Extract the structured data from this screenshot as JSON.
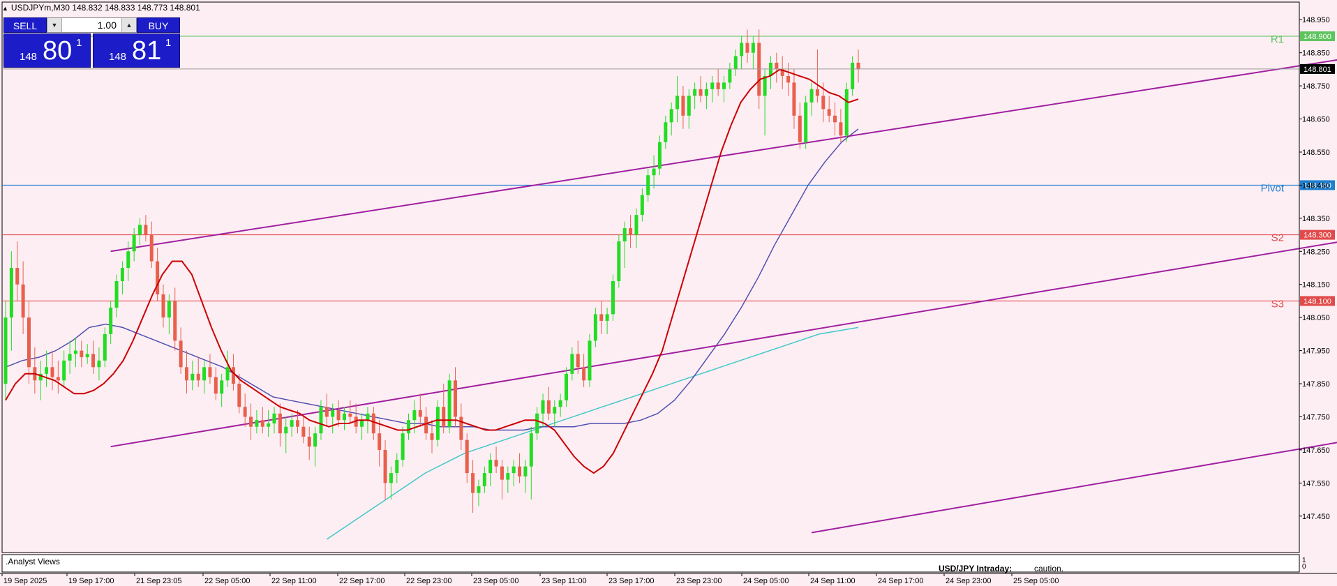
{
  "header": {
    "symbol_info": "USDJPYm,M30  148.832 148.833 148.773 148.801"
  },
  "trade_panel": {
    "sell_label": "SELL",
    "buy_label": "BUY",
    "lot": "1.00",
    "bid": {
      "small": "148",
      "big": "80",
      "sup": "1"
    },
    "ask": {
      "small": "148",
      "big": "81",
      "sup": "1"
    }
  },
  "indicator_panel": {
    "name": ".Analyst Views",
    "text_bold": "USD/JPY Intraday:",
    "text": "caution.",
    "scale_top": "1",
    "scale_bottom": "0"
  },
  "chart_data": {
    "type": "candlestick",
    "symbol": "USDJPYm",
    "timeframe": "M30",
    "ylim": [
      147.38,
      148.98
    ],
    "y_ticks": [
      "148.950",
      "148.850",
      "148.750",
      "148.650",
      "148.550",
      "148.450",
      "148.350",
      "148.250",
      "148.150",
      "148.050",
      "147.950",
      "147.850",
      "147.750",
      "147.650",
      "147.550",
      "147.450"
    ],
    "x_ticks": [
      "19 Sep 2025",
      "19 Sep 17:00",
      "21 Sep 23:05",
      "22 Sep 05:00",
      "22 Sep 11:00",
      "22 Sep 17:00",
      "22 Sep 23:00",
      "23 Sep 05:00",
      "23 Sep 11:00",
      "23 Sep 17:00",
      "23 Sep 23:00",
      "24 Sep 05:00",
      "24 Sep 11:00",
      "24 Sep 17:00",
      "24 Sep 23:00",
      "25 Sep 05:00"
    ],
    "current_price": "148.801",
    "levels": [
      {
        "name": "R1",
        "value": 148.9,
        "label": "148.900",
        "color": "#5ec45e"
      },
      {
        "name": "Pivot",
        "value": 148.45,
        "label": "148.450",
        "color": "#1e7fd0"
      },
      {
        "name": "S2",
        "value": 148.3,
        "label": "148.300",
        "color": "#e14a4a"
      },
      {
        "name": "S3",
        "value": 148.1,
        "label": "148.100",
        "color": "#e14a4a"
      }
    ],
    "bull_color": "#22dd22",
    "bear_color": "#e8604c",
    "ma_colors": {
      "fast": "#cc0000",
      "mid": "#5050b0",
      "slow": "#40c8c8",
      "channel": "#a020a0"
    },
    "ohlc": [
      [
        147.85,
        148.1,
        147.8,
        148.05
      ],
      [
        148.05,
        148.25,
        147.95,
        148.2
      ],
      [
        148.2,
        148.28,
        148.1,
        148.15
      ],
      [
        148.15,
        148.22,
        148.0,
        148.05
      ],
      [
        148.05,
        148.1,
        147.85,
        147.9
      ],
      [
        147.9,
        147.96,
        147.82,
        147.86
      ],
      [
        147.86,
        147.92,
        147.8,
        147.88
      ],
      [
        147.88,
        147.95,
        147.84,
        147.9
      ],
      [
        147.9,
        147.95,
        147.83,
        147.87
      ],
      [
        147.87,
        147.92,
        147.82,
        147.86
      ],
      [
        147.86,
        147.95,
        147.84,
        147.92
      ],
      [
        147.92,
        147.98,
        147.88,
        147.94
      ],
      [
        147.94,
        147.99,
        147.9,
        147.95
      ],
      [
        147.95,
        147.98,
        147.9,
        147.93
      ],
      [
        147.93,
        147.97,
        147.91,
        147.94
      ],
      [
        147.94,
        147.98,
        147.88,
        147.9
      ],
      [
        147.9,
        147.96,
        147.86,
        147.92
      ],
      [
        147.92,
        148.02,
        147.9,
        148.0
      ],
      [
        148.0,
        148.1,
        147.97,
        148.08
      ],
      [
        148.08,
        148.18,
        148.05,
        148.16
      ],
      [
        148.16,
        148.22,
        148.12,
        148.2
      ],
      [
        148.2,
        148.28,
        148.16,
        148.25
      ],
      [
        148.25,
        148.32,
        148.22,
        148.3
      ],
      [
        148.3,
        148.35,
        148.27,
        148.33
      ],
      [
        148.33,
        148.36,
        148.28,
        148.3
      ],
      [
        148.3,
        148.34,
        148.2,
        148.22
      ],
      [
        148.22,
        148.26,
        148.1,
        148.12
      ],
      [
        148.12,
        148.15,
        148.02,
        148.05
      ],
      [
        148.05,
        148.12,
        148.0,
        148.1
      ],
      [
        148.1,
        148.14,
        147.95,
        147.98
      ],
      [
        147.98,
        148.02,
        147.88,
        147.9
      ],
      [
        147.9,
        147.95,
        147.82,
        147.86
      ],
      [
        147.86,
        147.92,
        147.83,
        147.88
      ],
      [
        147.88,
        147.93,
        147.84,
        147.86
      ],
      [
        147.86,
        147.92,
        147.82,
        147.9
      ],
      [
        147.9,
        147.94,
        147.85,
        147.87
      ],
      [
        147.87,
        147.9,
        147.8,
        147.82
      ],
      [
        147.82,
        147.88,
        147.78,
        147.86
      ],
      [
        147.86,
        147.95,
        147.84,
        147.9
      ],
      [
        147.9,
        147.94,
        147.83,
        147.85
      ],
      [
        147.85,
        147.88,
        147.76,
        147.78
      ],
      [
        147.78,
        147.82,
        147.72,
        147.75
      ],
      [
        147.75,
        147.79,
        147.68,
        147.72
      ],
      [
        147.72,
        147.77,
        147.7,
        147.74
      ],
      [
        147.74,
        147.78,
        147.7,
        147.72
      ],
      [
        147.72,
        147.77,
        147.69,
        147.73
      ],
      [
        147.73,
        147.78,
        147.7,
        147.76
      ],
      [
        147.76,
        147.79,
        147.66,
        147.7
      ],
      [
        147.7,
        147.75,
        147.64,
        147.72
      ],
      [
        147.72,
        147.76,
        147.69,
        147.74
      ],
      [
        147.74,
        147.77,
        147.7,
        147.72
      ],
      [
        147.72,
        147.75,
        147.67,
        147.69
      ],
      [
        147.69,
        147.72,
        147.62,
        147.66
      ],
      [
        147.66,
        147.72,
        147.6,
        147.7
      ],
      [
        147.7,
        147.8,
        147.68,
        147.78
      ],
      [
        147.78,
        147.82,
        147.72,
        147.75
      ],
      [
        147.75,
        147.79,
        147.7,
        147.77
      ],
      [
        147.77,
        147.8,
        147.72,
        147.74
      ],
      [
        147.74,
        147.78,
        147.71,
        147.76
      ],
      [
        147.76,
        147.8,
        147.73,
        147.75
      ],
      [
        147.75,
        147.79,
        147.7,
        147.72
      ],
      [
        147.72,
        147.76,
        147.68,
        147.74
      ],
      [
        147.74,
        147.78,
        147.7,
        147.76
      ],
      [
        147.76,
        147.78,
        147.68,
        147.7
      ],
      [
        147.7,
        147.74,
        147.6,
        147.65
      ],
      [
        147.65,
        147.68,
        147.5,
        147.55
      ],
      [
        147.55,
        147.6,
        147.5,
        147.58
      ],
      [
        147.58,
        147.64,
        147.55,
        147.62
      ],
      [
        147.62,
        147.72,
        147.6,
        147.7
      ],
      [
        147.7,
        147.76,
        147.68,
        147.74
      ],
      [
        147.74,
        147.8,
        147.7,
        147.77
      ],
      [
        147.77,
        147.82,
        147.72,
        147.75
      ],
      [
        147.75,
        147.78,
        147.68,
        147.7
      ],
      [
        147.7,
        147.74,
        147.64,
        147.68
      ],
      [
        147.68,
        147.8,
        147.66,
        147.78
      ],
      [
        147.78,
        147.85,
        147.7,
        147.72
      ],
      [
        147.72,
        147.88,
        147.7,
        147.86
      ],
      [
        147.86,
        147.9,
        147.72,
        147.75
      ],
      [
        147.75,
        147.79,
        147.65,
        147.68
      ],
      [
        147.68,
        147.7,
        147.55,
        147.58
      ],
      [
        147.58,
        147.62,
        147.46,
        147.52
      ],
      [
        147.52,
        147.56,
        147.48,
        147.54
      ],
      [
        147.54,
        147.6,
        147.52,
        147.58
      ],
      [
        147.58,
        147.64,
        147.54,
        147.62
      ],
      [
        147.62,
        147.66,
        147.58,
        147.6
      ],
      [
        147.6,
        147.62,
        147.5,
        147.56
      ],
      [
        147.56,
        147.6,
        147.52,
        147.58
      ],
      [
        147.58,
        147.62,
        147.54,
        147.6
      ],
      [
        147.6,
        147.64,
        147.55,
        147.57
      ],
      [
        147.57,
        147.62,
        147.52,
        147.6
      ],
      [
        147.6,
        147.72,
        147.5,
        147.7
      ],
      [
        147.7,
        147.78,
        147.68,
        147.76
      ],
      [
        147.76,
        147.82,
        147.72,
        147.8
      ],
      [
        147.8,
        147.84,
        147.74,
        147.76
      ],
      [
        147.76,
        147.8,
        147.72,
        147.78
      ],
      [
        147.78,
        147.82,
        147.75,
        147.8
      ],
      [
        147.8,
        147.9,
        147.78,
        147.88
      ],
      [
        147.88,
        147.96,
        147.86,
        147.94
      ],
      [
        147.94,
        147.98,
        147.88,
        147.9
      ],
      [
        147.9,
        147.94,
        147.84,
        147.86
      ],
      [
        147.86,
        148.0,
        147.84,
        147.98
      ],
      [
        147.98,
        148.08,
        147.96,
        148.06
      ],
      [
        148.06,
        148.1,
        148.0,
        148.04
      ],
      [
        148.04,
        148.08,
        148.0,
        148.06
      ],
      [
        148.06,
        148.18,
        148.04,
        148.16
      ],
      [
        148.16,
        148.3,
        148.14,
        148.28
      ],
      [
        148.28,
        148.34,
        148.2,
        148.32
      ],
      [
        148.32,
        148.36,
        148.26,
        148.3
      ],
      [
        148.3,
        148.38,
        148.26,
        148.36
      ],
      [
        148.36,
        148.44,
        148.34,
        148.42
      ],
      [
        148.42,
        148.5,
        148.4,
        148.48
      ],
      [
        148.48,
        148.54,
        148.44,
        148.5
      ],
      [
        148.5,
        148.6,
        148.48,
        148.58
      ],
      [
        148.58,
        148.66,
        148.56,
        148.64
      ],
      [
        148.64,
        148.7,
        148.6,
        148.68
      ],
      [
        148.68,
        148.78,
        148.64,
        148.72
      ],
      [
        148.72,
        148.75,
        148.62,
        148.66
      ],
      [
        148.66,
        148.74,
        148.62,
        148.72
      ],
      [
        148.72,
        148.76,
        148.68,
        148.74
      ],
      [
        148.74,
        148.78,
        148.7,
        148.72
      ],
      [
        148.72,
        148.76,
        148.68,
        148.74
      ],
      [
        148.74,
        148.78,
        148.7,
        148.76
      ],
      [
        148.76,
        148.8,
        148.72,
        148.74
      ],
      [
        148.74,
        148.78,
        148.7,
        148.76
      ],
      [
        148.76,
        148.82,
        148.74,
        148.8
      ],
      [
        148.8,
        148.86,
        148.78,
        148.84
      ],
      [
        148.84,
        148.9,
        148.8,
        148.88
      ],
      [
        148.88,
        148.92,
        148.82,
        148.85
      ],
      [
        148.85,
        148.9,
        148.8,
        148.88
      ],
      [
        148.88,
        148.92,
        148.68,
        148.72
      ],
      [
        148.72,
        148.8,
        148.6,
        148.78
      ],
      [
        148.78,
        148.84,
        148.74,
        148.82
      ],
      [
        148.82,
        148.85,
        148.76,
        148.8
      ],
      [
        148.8,
        148.84,
        148.74,
        148.78
      ],
      [
        148.78,
        148.82,
        148.72,
        148.76
      ],
      [
        148.76,
        148.8,
        148.62,
        148.66
      ],
      [
        148.66,
        148.7,
        148.56,
        148.58
      ],
      [
        148.58,
        148.72,
        148.56,
        148.7
      ],
      [
        148.7,
        148.76,
        148.66,
        148.74
      ],
      [
        148.74,
        148.86,
        148.7,
        148.72
      ],
      [
        148.72,
        148.76,
        148.64,
        148.68
      ],
      [
        148.68,
        148.72,
        148.64,
        148.66
      ],
      [
        148.66,
        148.7,
        148.6,
        148.64
      ],
      [
        148.64,
        148.68,
        148.58,
        148.6
      ],
      [
        148.6,
        148.76,
        148.58,
        148.74
      ],
      [
        148.74,
        148.84,
        148.72,
        148.82
      ],
      [
        148.82,
        148.86,
        148.76,
        148.8
      ]
    ],
    "ma_fast": [
      147.8,
      147.85,
      147.88,
      147.88,
      147.87,
      147.86,
      147.84,
      147.82,
      147.82,
      147.83,
      147.85,
      147.88,
      147.92,
      147.98,
      148.05,
      148.12,
      148.18,
      148.22,
      148.22,
      148.18,
      148.1,
      148.02,
      147.95,
      147.89,
      147.86,
      147.84,
      147.82,
      147.8,
      147.78,
      147.77,
      147.76,
      147.74,
      147.73,
      147.72,
      147.73,
      147.73,
      147.74,
      147.74,
      147.73,
      147.72,
      147.71,
      147.71,
      147.72,
      147.73,
      147.74,
      147.74,
      147.74,
      147.73,
      147.72,
      147.71,
      147.71,
      147.72,
      147.73,
      147.74,
      147.74,
      147.73,
      147.71,
      147.67,
      147.63,
      147.6,
      147.58,
      147.6,
      147.64,
      147.7,
      147.76,
      147.82,
      147.88,
      147.95,
      148.05,
      148.15,
      148.25,
      148.35,
      148.45,
      148.55,
      148.63,
      148.7,
      148.74,
      148.77,
      148.78,
      148.8,
      148.79,
      148.78,
      148.77,
      148.75,
      148.73,
      148.72,
      148.7,
      148.71
    ],
    "ma_mid": [
      147.9,
      147.92,
      147.93,
      147.95,
      147.98,
      148.02,
      148.03,
      148.02,
      148.0,
      147.98,
      147.96,
      147.94,
      147.92,
      147.9,
      147.87,
      147.84,
      147.81,
      147.8,
      147.79,
      147.78,
      147.77,
      147.76,
      147.75,
      147.74,
      147.73,
      147.73,
      147.72,
      147.72,
      147.72,
      147.71,
      147.71,
      147.71,
      147.72,
      147.72,
      147.72,
      147.73,
      147.73,
      147.73,
      147.74,
      147.76,
      147.8,
      147.86,
      147.93,
      148.0,
      148.08,
      148.17,
      148.27,
      148.36,
      148.45,
      148.52,
      148.58,
      148.62
    ],
    "ma_slow": [
      147.38,
      147.42,
      147.46,
      147.5,
      147.54,
      147.58,
      147.61,
      147.64,
      147.66,
      147.68,
      147.7,
      147.72,
      147.74,
      147.76,
      147.78,
      147.8,
      147.82,
      147.84,
      147.86,
      147.88,
      147.9,
      147.92,
      147.94,
      147.96,
      147.98,
      148.0,
      148.01,
      148.02
    ],
    "channel": {
      "upper": [
        [
          18,
          148.25
        ],
        [
          283,
          148.98
        ]
      ],
      "middle": [
        [
          18,
          147.66
        ],
        [
          290,
          148.46
        ]
      ],
      "lower": [
        [
          138,
          147.4
        ],
        [
          290,
          147.86
        ]
      ]
    }
  }
}
